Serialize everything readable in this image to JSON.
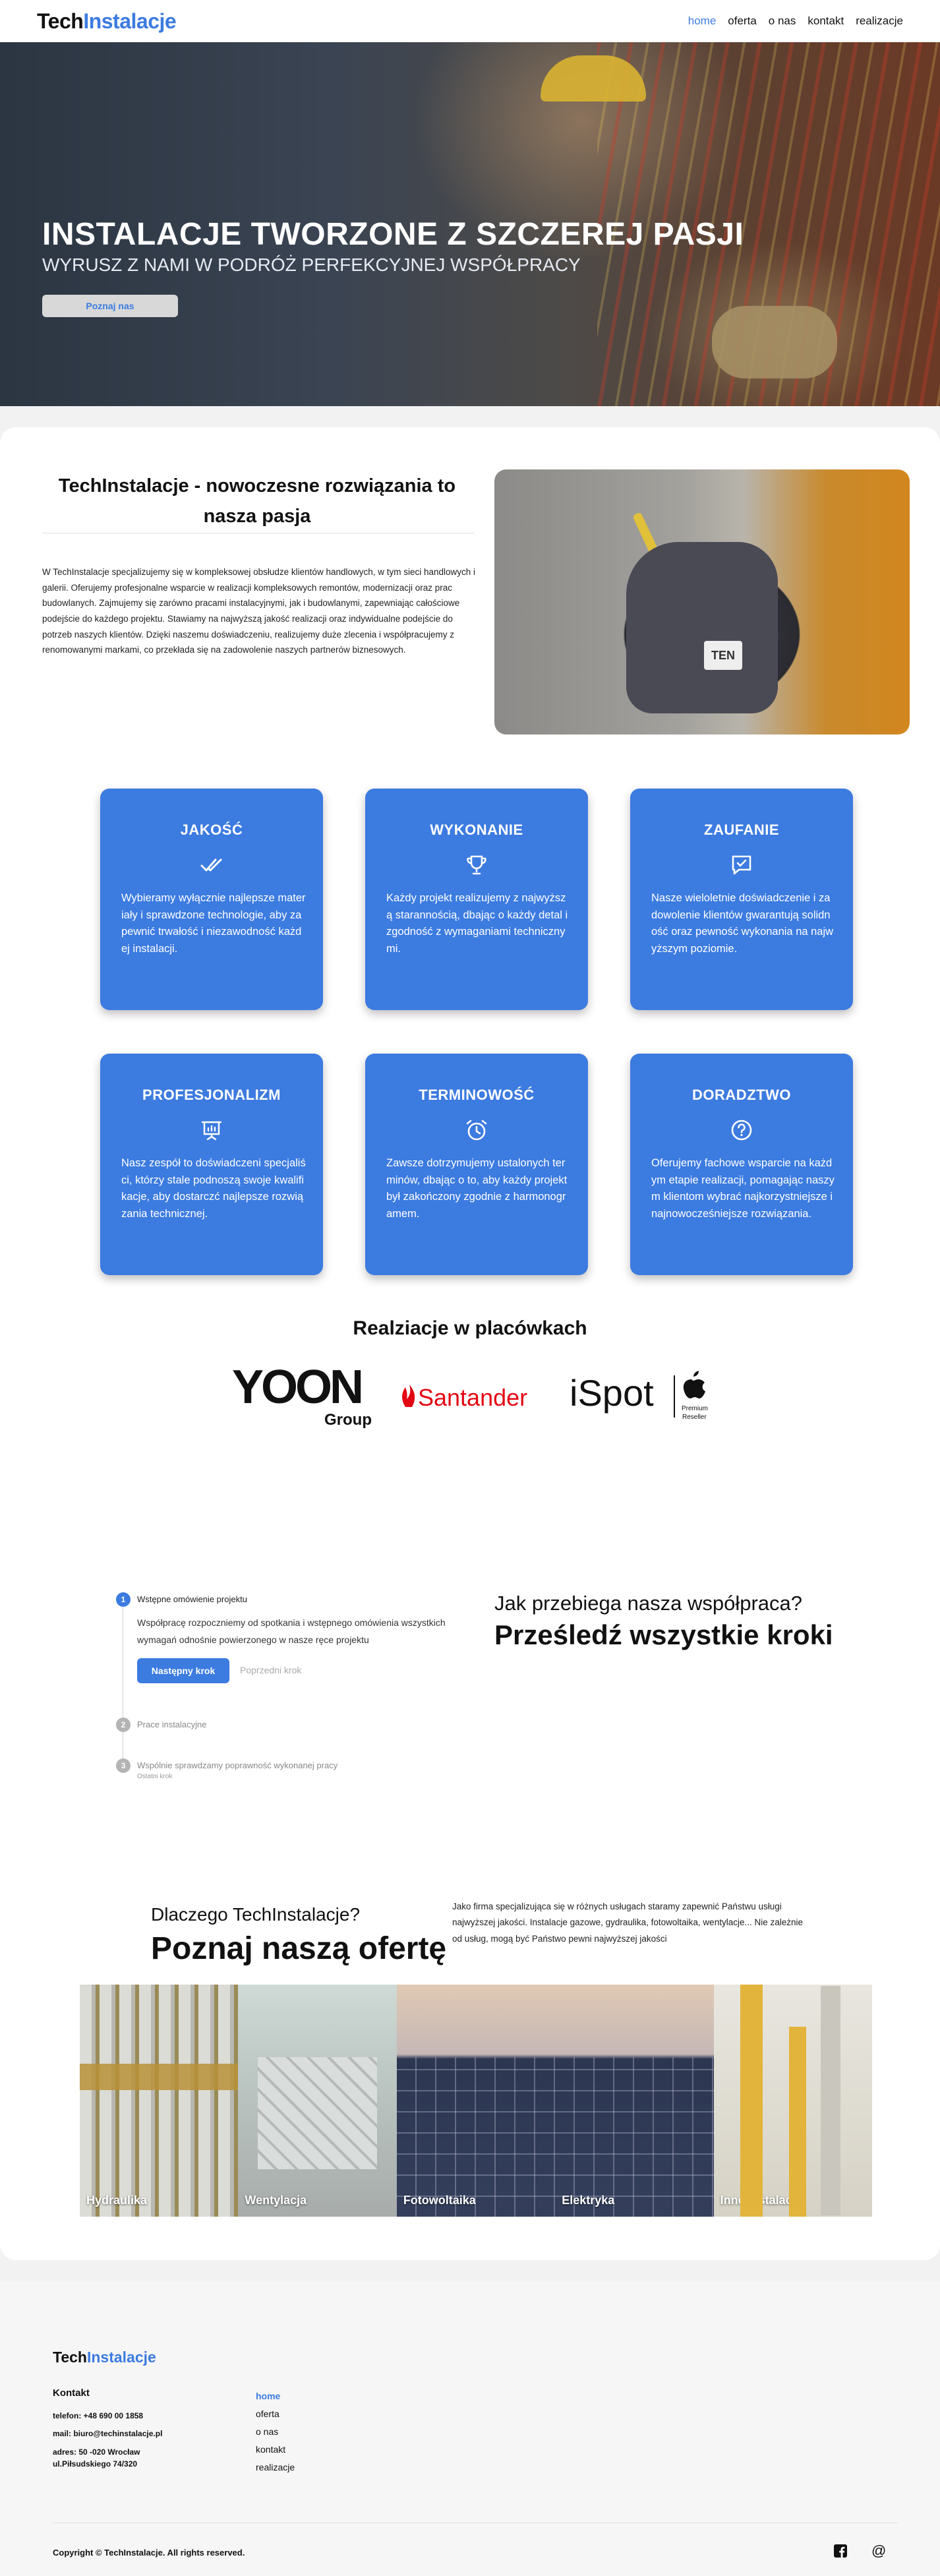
{
  "nav": {
    "logo_a": "Tech",
    "logo_b": "Instalacje",
    "items": [
      "home",
      "oferta",
      "o nas",
      "kontakt",
      "realizacje"
    ]
  },
  "hero": {
    "title": "INSTALACJE TWORZONE Z SZCZEREJ PASJI",
    "subtitle": "WYRUSZ Z NAMI W PODRÓŻ PERFEKCYJNEJ WSPÓŁPRACY",
    "button": "Poznaj nas"
  },
  "intro": {
    "title": "TechInstalacje - nowoczesne rozwiązania to nasza pasja",
    "text": "W TechInstalacje specjalizujemy się w kompleksowej obsłudze klientów handlowych, w tym sieci handlowych i galerii. Oferujemy profesjonalne wsparcie w realizacji kompleksowych remontów, modernizacji oraz prac budowlanych. Zajmujemy się zarówno pracami instalacyjnymi, jak i budowlanymi, zapewniając całościowe podejście do każdego projektu. Stawiamy na najwyższą jakość realizacji oraz indywidualne podejście do potrzeb naszych klientów. Dzięki naszemu doświadczeniu, realizujemy duże zlecenia i współpracujemy z renomowanymi markami, co przekłada się na zadowolenie naszych partnerów biznesowych.",
    "image_tag": "TEN"
  },
  "features": [
    {
      "title": "JAKOŚĆ",
      "icon": "double-check-icon",
      "text": "Wybieramy wyłącznie najlepsze materiały i sprawdzone technologie, aby zapewnić trwałość i niezawodność każdej instalacji."
    },
    {
      "title": "WYKONANIE",
      "icon": "trophy-icon",
      "text": "Każdy projekt realizujemy z najwyższą starannością, dbając o każdy detal i zgodność z wymaganiami technicznymi."
    },
    {
      "title": "ZAUFANIE",
      "icon": "checked-chat-icon",
      "text": "Nasze wieloletnie doświadczenie i zadowolenie klientów gwarantują solidność oraz pewność wykonania na najwyższym poziomie."
    },
    {
      "title": "PROFESJONALIZM",
      "icon": "presentation-icon",
      "text": "Nasz zespół to doświadczeni specjaliści, którzy stale podnoszą swoje kwalifikacje, aby dostarczć najlepsze rozwiązania technicznej."
    },
    {
      "title": "TERMINOWOŚĆ",
      "icon": "alarm-clock-icon",
      "text": "Zawsze dotrzymujemy ustalonych terminów, dbając o to, aby każdy projekt był zakończony zgodnie z harmonogramem."
    },
    {
      "title": "DORADZTWO",
      "icon": "question-circle-icon",
      "text": "Oferujemy fachowe wsparcie na każdym etapie realizacji, pomagając naszym klientom wybrać najkorzystniejsze i najnowocześniejsze rozwiązania."
    }
  ],
  "realizations": {
    "title": "Realziacje w placówkach",
    "logos": {
      "yoon": "YOON",
      "yoon_sub": "Group",
      "santander": "Santander",
      "ispot": "iSpot",
      "premium_1": "Premium",
      "premium_2": "Reseller"
    }
  },
  "steps": {
    "items": [
      {
        "number": "1",
        "label": "Wstępne omówienie projektu"
      },
      {
        "number": "2",
        "label": "Prace instalacyjne"
      },
      {
        "number": "3",
        "label": "Wspólnie sprawdzamy poprawność wykonanej pracy"
      }
    ],
    "description": "Współpracę rozpoczniemy od spotkania i wstępnego omówienia wszystkich wymagań odnośnie powierzonego w nasze ręce projektu",
    "next_button": "Następny krok",
    "prev_button": "Poprzedni krok",
    "last_note": "Ostatni krok"
  },
  "cooperation": {
    "question": "Jak przebiega nasza współpraca?",
    "headline": "Prześledź wszystkie kroki"
  },
  "offer": {
    "small": "Dlaczego TechInstalacje?",
    "big": "Poznaj naszą ofertę",
    "text": "Jako firma specjalizująca się w różnych usługach staramy zapewnić Państwu usługi najwyższej jakości. Instalacje gazowe, gydraulika, fotowoltaika, wentylacje... Nie zależnie od usług, mogą być Państwo pewni najwyższej jakości",
    "tiles": [
      "Hydraulika",
      "Wentylacja",
      "Fotowoltaika",
      "Elektryka",
      "Inne Instalacje"
    ]
  },
  "footer": {
    "logo_a": "Tech",
    "logo_b": "Instalacje",
    "contact_heading": "Kontakt",
    "phone": "telefon: +48 690 00 1858",
    "mail": "mail: biuro@techinstalacje.pl",
    "address": "adres: 50 -020 Wrocław ul.Piłsudskiego 74/320",
    "links": [
      "home",
      "oferta",
      "o nas",
      "kontakt",
      "realizacje"
    ],
    "copyright": "Copyright © TechInstalacje. All rights reserved."
  },
  "colors": {
    "accent": "#3c7be0",
    "card": "#3c7be0",
    "text": "#111111"
  }
}
